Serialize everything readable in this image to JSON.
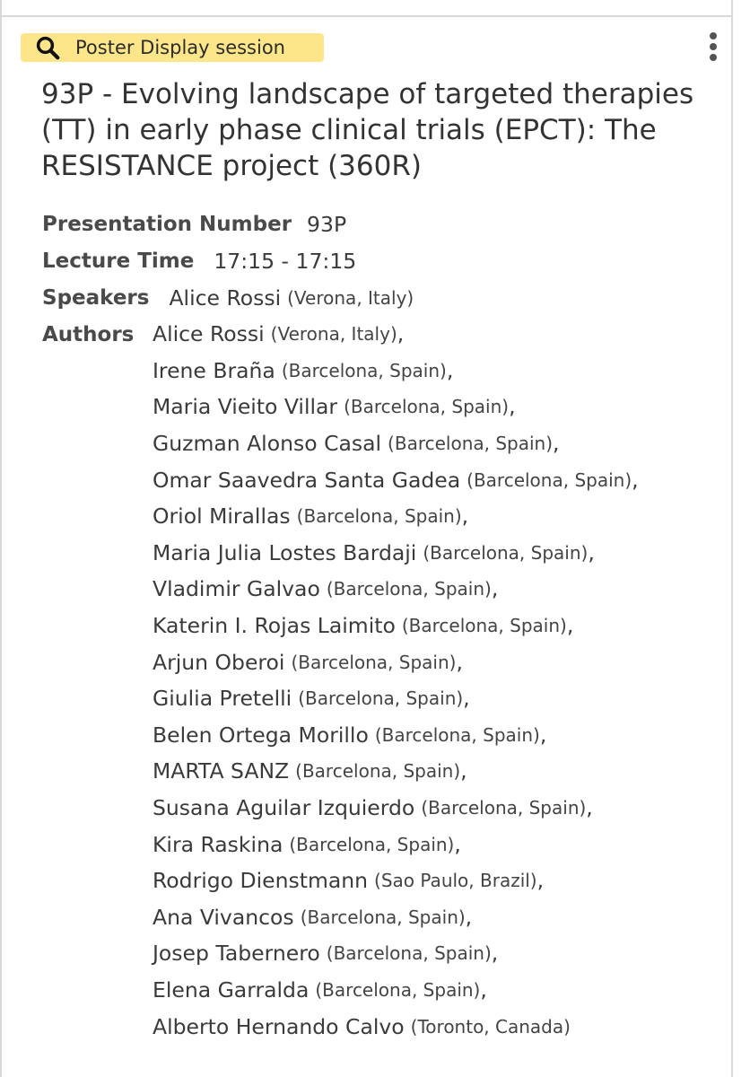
{
  "session": {
    "label": "Poster Display session",
    "icon": "search-icon",
    "badge_color": "#fde68a"
  },
  "menu": {
    "icon": "more-vertical-icon"
  },
  "title": "93P - Evolving landscape of targeted therapies (TT) in early phase clinical trials (EPCT): The RESISTANCE project (360R)",
  "presentation_number": {
    "label": "Presentation Number",
    "value": "93P"
  },
  "lecture_time": {
    "label": "Lecture Time",
    "value": "17:15 - 17:15"
  },
  "speakers": {
    "label": "Speakers",
    "name": "Alice Rossi",
    "location": "(Verona, Italy)"
  },
  "authors": {
    "label": "Authors",
    "items": [
      {
        "name": "Alice Rossi",
        "location": "(Verona, Italy)",
        "sep": ","
      },
      {
        "name": "Irene Braña",
        "location": "(Barcelona, Spain)",
        "sep": ","
      },
      {
        "name": "Maria Vieito Villar",
        "location": "(Barcelona, Spain)",
        "sep": ","
      },
      {
        "name": "Guzman Alonso Casal",
        "location": "(Barcelona, Spain)",
        "sep": ","
      },
      {
        "name": "Omar Saavedra Santa Gadea",
        "location": "(Barcelona, Spain)",
        "sep": ","
      },
      {
        "name": "Oriol Mirallas",
        "location": "(Barcelona, Spain)",
        "sep": ","
      },
      {
        "name": "Maria Julia Lostes Bardaji",
        "location": "(Barcelona, Spain)",
        "sep": ","
      },
      {
        "name": "Vladimir Galvao",
        "location": "(Barcelona, Spain)",
        "sep": ","
      },
      {
        "name": "Katerin I. Rojas Laimito",
        "location": "(Barcelona, Spain)",
        "sep": ","
      },
      {
        "name": "Arjun Oberoi",
        "location": "(Barcelona, Spain)",
        "sep": ","
      },
      {
        "name": "Giulia Pretelli",
        "location": "(Barcelona, Spain)",
        "sep": ","
      },
      {
        "name": "Belen Ortega Morillo",
        "location": "(Barcelona, Spain)",
        "sep": ","
      },
      {
        "name": "MARTA SANZ",
        "location": "(Barcelona, Spain)",
        "sep": ","
      },
      {
        "name": "Susana Aguilar Izquierdo",
        "location": "(Barcelona, Spain)",
        "sep": ","
      },
      {
        "name": "Kira Raskina",
        "location": "(Barcelona, Spain)",
        "sep": ","
      },
      {
        "name": "Rodrigo Dienstmann",
        "location": "(Sao Paulo, Brazil)",
        "sep": ","
      },
      {
        "name": "Ana Vivancos",
        "location": "(Barcelona, Spain)",
        "sep": ","
      },
      {
        "name": "Josep Tabernero",
        "location": "(Barcelona, Spain)",
        "sep": ","
      },
      {
        "name": "Elena Garralda",
        "location": "(Barcelona, Spain)",
        "sep": ","
      },
      {
        "name": "Alberto Hernando Calvo",
        "location": "(Toronto, Canada)",
        "sep": ""
      }
    ]
  }
}
